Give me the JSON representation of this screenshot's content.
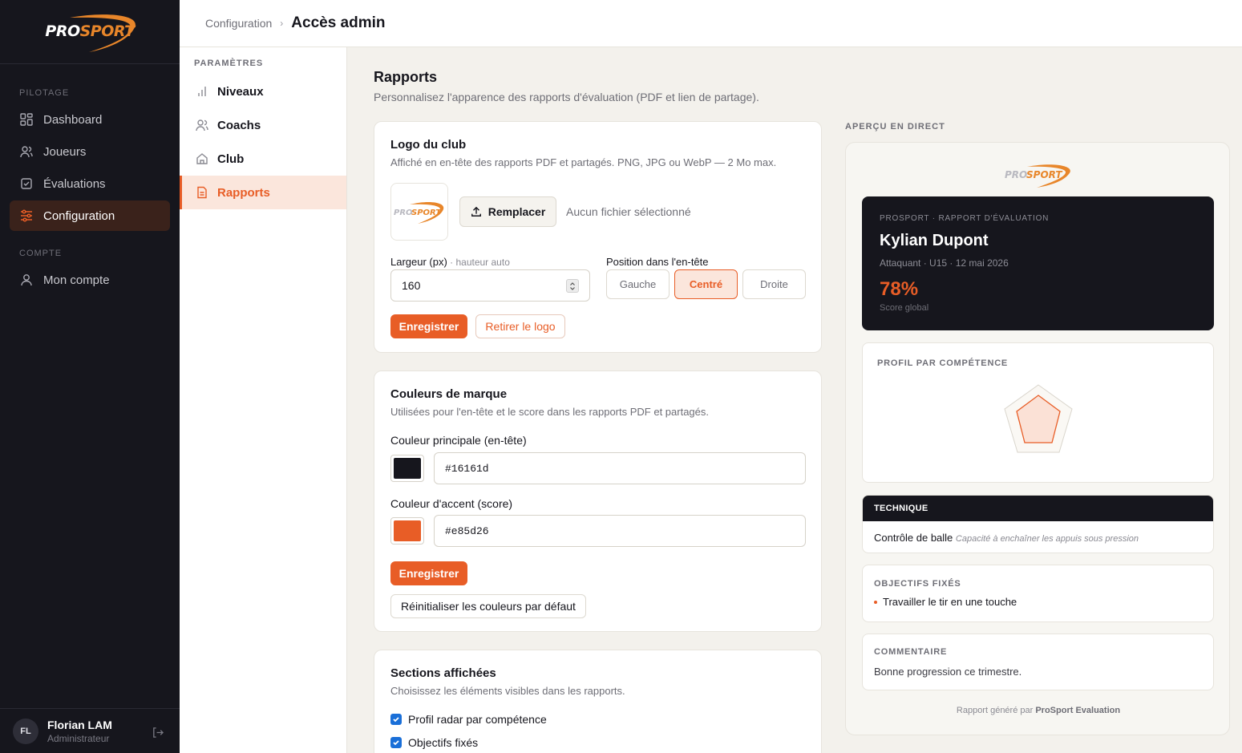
{
  "brand": {
    "pro": "PRO",
    "sport": "SPORT"
  },
  "sidebar": {
    "section_pilotage": "PILOTAGE",
    "items": [
      {
        "label": "Dashboard",
        "icon": "dashboard-icon"
      },
      {
        "label": "Joueurs",
        "icon": "users-icon"
      },
      {
        "label": "Évaluations",
        "icon": "clipboard-check-icon"
      },
      {
        "label": "Configuration",
        "icon": "sliders-icon",
        "active": true
      }
    ],
    "section_compte": "COMPTE",
    "account_item": {
      "label": "Mon compte",
      "icon": "user-icon"
    },
    "user": {
      "initials": "FL",
      "name": "Florian LAM",
      "role": "Administrateur"
    }
  },
  "topbar": {
    "crumb": "Configuration",
    "separator": "›",
    "current": "Accès admin"
  },
  "subnav": {
    "title": "PARAMÈTRES",
    "items": [
      {
        "label": "Niveaux",
        "icon": "bar-chart-icon"
      },
      {
        "label": "Coachs",
        "icon": "users-icon"
      },
      {
        "label": "Club",
        "icon": "home-icon"
      },
      {
        "label": "Rapports",
        "icon": "document-icon",
        "active": true
      }
    ]
  },
  "page": {
    "title": "Rapports",
    "subtitle": "Personnalisez l'apparence des rapports d'évaluation (PDF et lien de partage)."
  },
  "logo_card": {
    "title": "Logo du club",
    "desc": "Affiché en en-tête des rapports PDF et partagés. PNG, JPG ou WebP — 2 Mo max.",
    "replace_label": "Remplacer",
    "no_file": "Aucun fichier sélectionné",
    "width_label": "Largeur (px)",
    "width_hint": " · hauteur auto",
    "width_value": "160",
    "position_label": "Position dans l'en-tête",
    "positions": [
      "Gauche",
      "Centré",
      "Droite"
    ],
    "selected_position": "Centré",
    "save_label": "Enregistrer",
    "remove_label": "Retirer le logo"
  },
  "colors_card": {
    "title": "Couleurs de marque",
    "desc": "Utilisées pour l'en-tête et le score dans les rapports PDF et partagés.",
    "primary_label": "Couleur principale (en-tête)",
    "primary_value": "#16161d",
    "accent_label": "Couleur d'accent (score)",
    "accent_value": "#e85d26",
    "save_label": "Enregistrer",
    "reset_label": "Réinitialiser les couleurs par défaut"
  },
  "sections_card": {
    "title": "Sections affichées",
    "desc": "Choisissez les éléments visibles dans les rapports.",
    "options": [
      {
        "label": "Profil radar par compétence",
        "checked": true
      },
      {
        "label": "Objectifs fixés",
        "checked": true
      }
    ]
  },
  "preview": {
    "label": "APERÇU EN DIRECT",
    "kicker": "PROSPORT · RAPPORT D'ÉVALUATION",
    "player": "Kylian Dupont",
    "meta": "Attaquant · U15 · 12 mai 2026",
    "score": "78%",
    "score_label": "Score global",
    "radar_title": "PROFIL PAR COMPÉTENCE",
    "technique_title": "TECHNIQUE",
    "technique_item": "Contrôle de balle",
    "technique_note": "Capacité à enchaîner les appuis sous pression",
    "objectives_title": "OBJECTIFS FIXÉS",
    "objective_item": "Travailler le tir en une touche",
    "comment_title": "COMMENTAIRE",
    "comment": "Bonne progression ce trimestre.",
    "footer_prefix": "Rapport généré par ",
    "footer_brand": "ProSport Evaluation"
  },
  "colors": {
    "accent": "#e85d26",
    "dark": "#16161d",
    "brand_orange": "#e8862a"
  }
}
